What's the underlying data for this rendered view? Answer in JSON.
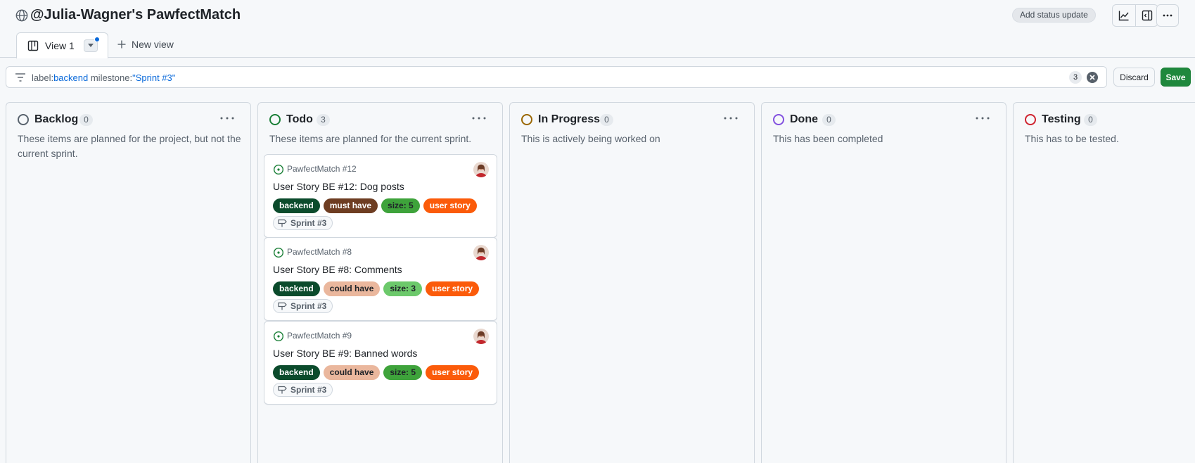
{
  "header": {
    "title": "@Julia-Wagner's PawfectMatch",
    "status_update_label": "Add status update",
    "icons": [
      "globe-icon",
      "insights-chart-icon",
      "sidebar-panel-icon",
      "kebab-icon"
    ]
  },
  "tabs": {
    "current": "View 1",
    "new_view_label": "New view"
  },
  "filter": {
    "key1": "label:",
    "value1": "backend",
    "key2": " milestone:",
    "value2": "\"Sprint #3\"",
    "count": "3",
    "discard_label": "Discard",
    "save_label": "Save"
  },
  "colors": {
    "accent_blue": "#0969da",
    "save_green": "#1f883d"
  },
  "columns": [
    {
      "name": "Backlog",
      "count": "0",
      "description": "These items are planned for the project, but not the current sprint.",
      "status_color": "#59636e"
    },
    {
      "name": "Todo",
      "count": "3",
      "description": "These items are planned for the current sprint.",
      "status_color": "#1a7f37"
    },
    {
      "name": "In Progress",
      "count": "0",
      "description": "This is actively being worked on",
      "status_color": "#9a6700"
    },
    {
      "name": "Done",
      "count": "0",
      "description": "This has been completed",
      "status_color": "#8250df"
    },
    {
      "name": "Testing",
      "count": "0",
      "description": "This has to be tested.",
      "status_color": "#cf222e"
    }
  ],
  "cards": [
    {
      "repo": "PawfectMatch #12",
      "title": "User Story BE #12: Dog posts",
      "labels": [
        "backend",
        "must have",
        "size: 5",
        "user story"
      ],
      "milestone": "Sprint #3"
    },
    {
      "repo": "PawfectMatch #8",
      "title": "User Story BE #8: Comments",
      "labels": [
        "backend",
        "could have",
        "size: 3",
        "user story"
      ],
      "milestone": "Sprint #3"
    },
    {
      "repo": "PawfectMatch #9",
      "title": "User Story BE #9: Banned words",
      "labels": [
        "backend",
        "could have",
        "size: 5",
        "user story"
      ],
      "milestone": "Sprint #3"
    }
  ],
  "label_colors": {
    "backend": "#0b4b2c",
    "must have": "#6e3d22",
    "could have": "#eab79d",
    "size: 5": "#3ea33b",
    "size: 3": "#6cc96b",
    "user story": "#fb5b0a"
  }
}
